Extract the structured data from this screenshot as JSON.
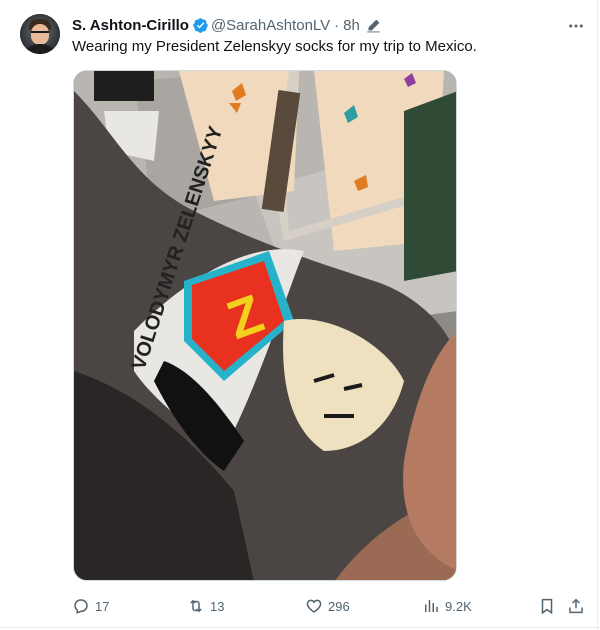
{
  "author": {
    "display_name": "S. Ashton-Cirillo",
    "handle": "@SarahAshtonLV",
    "separator": "·",
    "time": "8h",
    "verified": true
  },
  "tweet": {
    "text": "Wearing my President Zelenskyy socks for my trip to Mexico.",
    "image_description_icon": "photo-media"
  },
  "actions": {
    "replies": "17",
    "retweets": "13",
    "likes": "296",
    "views": "9.2K"
  },
  "media": {
    "sock_text": "VOLODYMYR ZELENSKYY",
    "z_letter": "Z"
  },
  "colors": {
    "verified": "#1d9bf0",
    "secondary_text": "#536471",
    "primary_text": "#0f1419",
    "border": "#cfd9de"
  },
  "icons": {
    "more": "more-dots-icon",
    "edit": "edit-pencil-icon",
    "reply": "reply-icon",
    "retweet": "retweet-icon",
    "like": "heart-icon",
    "views": "views-chart-icon",
    "bookmark": "bookmark-icon",
    "share": "share-icon"
  }
}
